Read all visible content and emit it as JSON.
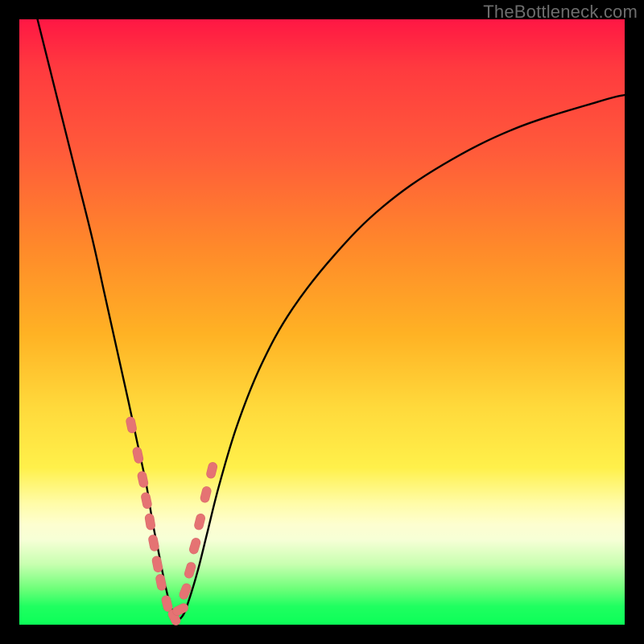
{
  "watermark": "TheBottleneck.com",
  "colors": {
    "frame": "#000000",
    "curve_stroke": "#000000",
    "marker_fill": "#e57373",
    "marker_stroke": "#d86a6a",
    "gradient_stops": [
      "#ff1744",
      "#ff8a2a",
      "#ffd93b",
      "#fffca8",
      "#0cff58"
    ]
  },
  "chart_data": {
    "type": "line",
    "title": "",
    "xlabel": "",
    "ylabel": "",
    "xlim": [
      0,
      100
    ],
    "ylim": [
      0,
      100
    ],
    "grid": false,
    "legend": false,
    "note": "Axes are unlabeled in the source image. x and y are estimated as percent of plot width/height (0,0 at bottom-left). The curve is a V-shaped bottleneck curve; y appears to encode mismatch percentage (red=high, green=low).",
    "series": [
      {
        "name": "bottleneck-curve",
        "x": [
          3,
          6,
          9,
          12,
          14,
          16,
          18,
          19.5,
          21,
          22,
          23,
          24,
          25,
          26,
          27,
          28,
          29.5,
          31,
          33,
          36,
          40,
          45,
          52,
          60,
          70,
          82,
          96,
          100
        ],
        "y": [
          100,
          88,
          76,
          64,
          55,
          46,
          37,
          30,
          23,
          17,
          12,
          7,
          3,
          1,
          1.5,
          4,
          9,
          15,
          23,
          33,
          43,
          52,
          61,
          69,
          76,
          82,
          86.5,
          87.5
        ]
      }
    ],
    "markers": {
      "name": "highlighted-points",
      "note": "Pink capsule markers near the V; values estimated.",
      "x": [
        18.5,
        19.6,
        20.4,
        21.0,
        21.6,
        22.2,
        22.8,
        23.4,
        24.4,
        25.6,
        26.6,
        27.4,
        28.2,
        29.0,
        29.8,
        30.8,
        31.8
      ],
      "y": [
        33,
        28,
        24,
        20.5,
        17,
        13.5,
        10,
        7,
        3.5,
        1.2,
        2.5,
        5.5,
        9,
        13,
        17,
        21.5,
        25.5
      ]
    }
  }
}
